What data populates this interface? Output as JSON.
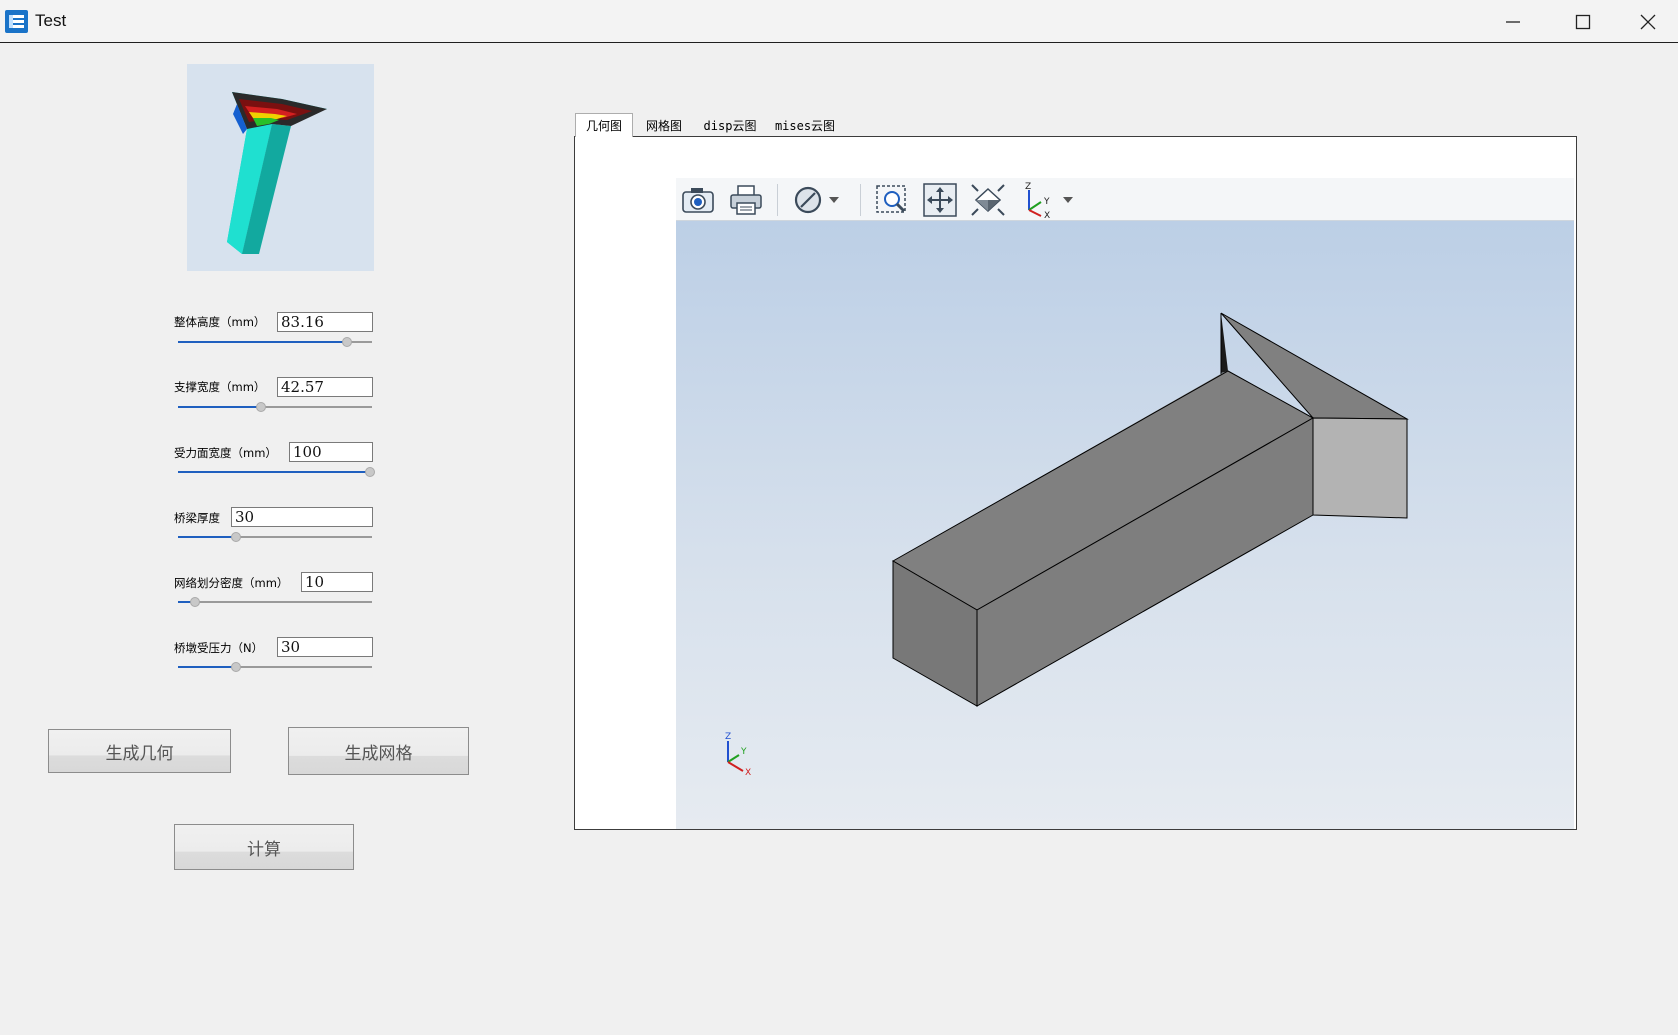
{
  "window": {
    "title": "Test",
    "controls": [
      "minimize",
      "maximize",
      "close"
    ]
  },
  "params": [
    {
      "label": "整体高度（mm）",
      "value": "83.16",
      "slider_fraction": 0.87
    },
    {
      "label": "支撑宽度（mm）",
      "value": "42.57",
      "slider_fraction": 0.43
    },
    {
      "label": "受力面宽度（mm）",
      "value": "100",
      "slider_fraction": 0.99
    },
    {
      "label": "桥梁厚度",
      "value": "30",
      "slider_fraction": 0.3
    },
    {
      "label": "网络划分密度（mm）",
      "value": "10",
      "slider_fraction": 0.09
    },
    {
      "label": "桥墩受压力（N）",
      "value": "30",
      "slider_fraction": 0.3
    }
  ],
  "buttons": {
    "generate_geometry": "生成几何",
    "generate_mesh": "生成网格",
    "compute": "计算"
  },
  "tabs": [
    {
      "label": "几何图",
      "active": true
    },
    {
      "label": "网格图",
      "active": false
    },
    {
      "label": "disp云图",
      "active": false
    },
    {
      "label": "mises云图",
      "active": false
    }
  ],
  "viewer": {
    "toolbar": [
      "camera-icon",
      "print-icon",
      "clip-plane-icon",
      "zoom-box-icon",
      "fit-all-icon",
      "view-iso-icon",
      "axes-icon"
    ],
    "triad_labels": {
      "z": "Z",
      "y": "Y",
      "x": "X"
    },
    "axis_icon_labels": {
      "z": "Z",
      "y": "Y",
      "x": "X"
    }
  },
  "colors": {
    "accent": "#1f5fbf",
    "model_top": "#7f7f7f",
    "model_side": "#6b6b6b",
    "model_end": "#b3b3b3",
    "viewport_top": "#bccfe6",
    "viewport_bottom": "#e6ebf1"
  }
}
